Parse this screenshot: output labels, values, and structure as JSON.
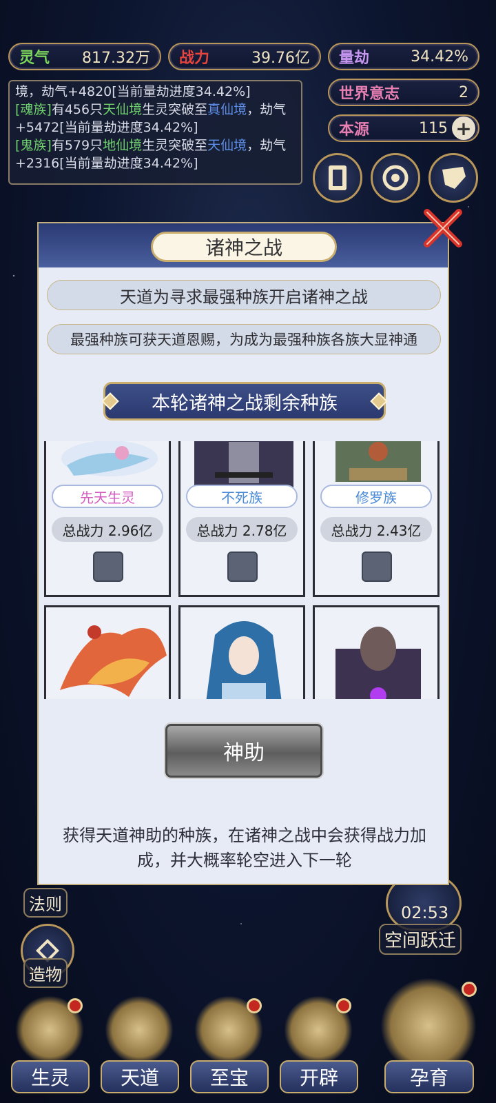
{
  "resources": {
    "lingqi": {
      "label": "灵气",
      "value": "817.32万"
    },
    "zhanli": {
      "label": "战力",
      "value": "39.76亿"
    },
    "liangjie": {
      "label": "量劫",
      "value": "34.42%"
    },
    "world_will": {
      "label": "世界意志",
      "value": "2"
    },
    "origin": {
      "label": "本源",
      "value": "115"
    }
  },
  "log": {
    "line0": "境，劫气+4820[当前量劫进度34.42%]",
    "entry1": {
      "race": "[魂族]",
      "t1": "有456只",
      "from": "天仙境",
      "t2": "生灵突破至",
      "to": "真仙境",
      "tail": "，劫气+5472[当前量劫进度34.42%]"
    },
    "entry2": {
      "race": "[鬼族]",
      "t1": "有579只",
      "from": "地仙境",
      "t2": "生灵突破至",
      "to": "天仙境",
      "tail": "，劫气+2316[当前量劫进度34.42%]"
    }
  },
  "dialog": {
    "title": "诸神之战",
    "line1": "天道为寻求最强种族开启诸神之战",
    "line2": "最强种族可获天道恩赐，为成为最强种族各族大显神通",
    "section_title": "本轮诸神之战剩余种族",
    "cards_row1": [
      {
        "name": "先天生灵",
        "power": "总战力 2.96亿",
        "name_color": "#d35bc1"
      },
      {
        "name": "不死族",
        "power": "总战力 2.78亿",
        "name_color": "#4a8ad6"
      },
      {
        "name": "修罗族",
        "power": "总战力 2.43亿",
        "name_color": "#4a8ad6"
      }
    ],
    "help_button": "神助",
    "footer": "获得天道神助的种族，在诸神之战中会获得战力加成，并大概率轮空进入下一轮"
  },
  "side": {
    "law": "法则",
    "creation": "造物",
    "timer": "02:53",
    "space_jump": "空间跃迁"
  },
  "nav": [
    "生灵",
    "天道",
    "至宝",
    "开辟",
    "孕育"
  ]
}
